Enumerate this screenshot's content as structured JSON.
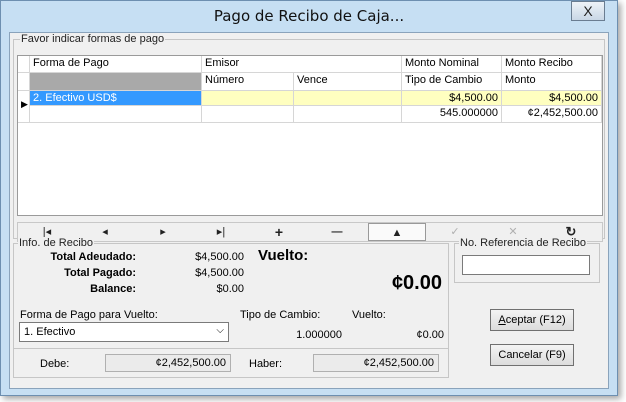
{
  "window": {
    "title": "Pago de Recibo de Caja...",
    "close": "X"
  },
  "payments": {
    "legend": "Favor indicar formas de pago",
    "headers": {
      "forma": "Forma de Pago",
      "emisor": "Emisor",
      "numero": "Número",
      "vence": "Vence",
      "monto_nominal": "Monto Nominal",
      "tipo_cambio": "Tipo de Cambio",
      "monto_recibo": "Monto Recibo",
      "monto": "Monto"
    },
    "row": {
      "forma": "2. Efectivo USD$",
      "monto_nominal": "$4,500.00",
      "monto_recibo": "$4,500.00",
      "tipo_cambio": "545.000000",
      "monto": "¢2,452,500.00"
    },
    "row_indicator": "▶"
  },
  "nav": {
    "first": "|◂",
    "prev": "◂",
    "next": "▸",
    "last": "▸|",
    "add": "+",
    "remove": "—",
    "up": "▲",
    "check": "✓",
    "cancel": "✕",
    "refresh": "↻"
  },
  "info": {
    "legend": "Info. de Recibo",
    "total_adeudado_label": "Total Adeudado:",
    "total_adeudado": "$4,500.00",
    "total_pagado_label": "Total Pagado:",
    "total_pagado": "$4,500.00",
    "balance_label": "Balance:",
    "balance": "$0.00",
    "vuelto_label": "Vuelto:",
    "vuelto_big": "¢0.00",
    "forma_vuelto_label": "Forma de Pago para Vuelto:",
    "forma_vuelto_value": "1. Efectivo",
    "tipo_cambio_label": "Tipo de Cambio:",
    "tipo_cambio_value": "1.000000",
    "vuelto_small_label": "Vuelto:",
    "vuelto_small_value": "¢0.00",
    "debe_label": "Debe:",
    "debe_value": "¢2,452,500.00",
    "haber_label": "Haber:",
    "haber_value": "¢2,452,500.00"
  },
  "referencia": {
    "legend": "No. Referencia de Recibo",
    "value": ""
  },
  "buttons": {
    "aceptar_u": "A",
    "aceptar_rest": "ceptar (F12)",
    "cancelar": "Cancelar (F9)"
  }
}
